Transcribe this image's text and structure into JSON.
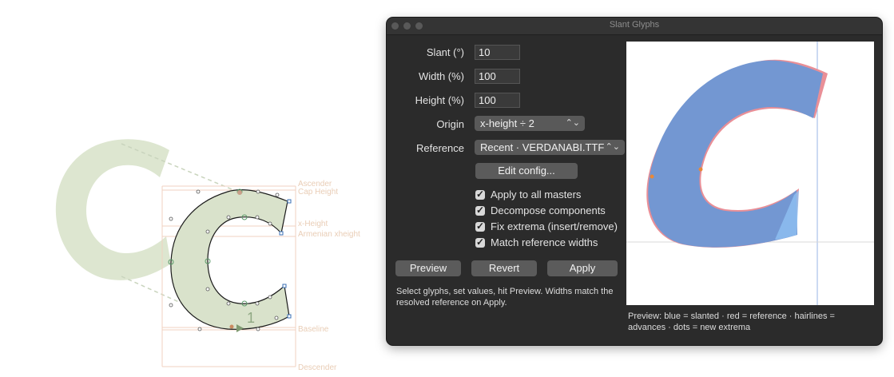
{
  "canvas": {
    "glyph_outline_name": "c",
    "metric_labels": [
      "Ascender",
      "Cap Height",
      "x-Height",
      "Armenian xheight",
      "Baseline",
      "Descender"
    ],
    "glyph_number": "1",
    "colors": {
      "glyph_fill": "#d9e2cb",
      "ghost_fill": "#dde6d0",
      "metric_line": "#efc9b3",
      "guide": "#a7b89a"
    }
  },
  "window": {
    "title": "Slant Glyphs",
    "fields": {
      "slant": {
        "label": "Slant (°)",
        "value": "10"
      },
      "width": {
        "label": "Width (%)",
        "value": "100"
      },
      "height": {
        "label": "Height (%)",
        "value": "100"
      }
    },
    "origin": {
      "label": "Origin",
      "value": "x-height ÷ 2"
    },
    "reference": {
      "label": "Reference",
      "value": "Recent · VERDANABI.TTF"
    },
    "edit_config_label": "Edit config...",
    "options": [
      {
        "label": "Apply to all masters",
        "checked": true
      },
      {
        "label": "Decompose components",
        "checked": true
      },
      {
        "label": "Fix extrema (insert/remove)",
        "checked": true
      },
      {
        "label": "Match reference widths",
        "checked": true
      }
    ],
    "buttons": {
      "preview": "Preview",
      "revert": "Revert",
      "apply": "Apply"
    },
    "hint": "Select glyphs, set values, hit Preview. Widths match the resolved reference on Apply.",
    "preview_caption": "Preview: blue = slanted · red = reference · hairlines = advances · dots = new extrema",
    "colors": {
      "slanted": "#7397d2",
      "reference": "#e98f97",
      "extrema_dot": "#e8883a",
      "hairline": "#9ab6e6"
    }
  }
}
